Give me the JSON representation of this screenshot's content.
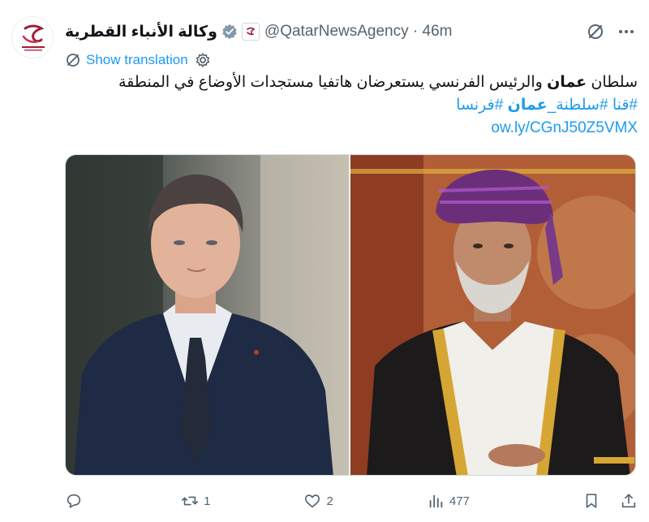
{
  "account": {
    "display_name": "وكالة الأنباء القطرية",
    "handle": "@QatarNewsAgency",
    "separator": "·",
    "time_ago": "46m",
    "avatar_icon": "qna-logo-icon",
    "verified_icon": "verified-badge-icon",
    "affiliate_icon": "affiliate-badge-icon"
  },
  "header_actions": {
    "grok_icon": "grok-icon",
    "more_icon": "more-dots-icon"
  },
  "translation": {
    "label": "Show translation",
    "icon": "translate-icon",
    "settings_icon": "gear-icon"
  },
  "tweet": {
    "text_part1": "سلطان ",
    "text_bold1": "عمان",
    "text_part2": " والرئيس الفرنسي يستعرضان هاتفيا مستجدات الأوضاع في المنطقة",
    "hashtag1": "#قنا",
    "hashtag2_pre": "#سلطنة_",
    "hashtag2_bold": "عمان",
    "hashtag3": "#فرنسا",
    "link": "ow.ly/CGnJ50Z5VMX"
  },
  "media": {
    "left_image": "photo-man-in-suit",
    "right_image": "photo-man-in-turban"
  },
  "actions": {
    "reply_icon": "reply-icon",
    "reply_count": "",
    "retweet_icon": "retweet-icon",
    "retweet_count": "1",
    "like_icon": "heart-icon",
    "like_count": "2",
    "views_icon": "views-icon",
    "views_count": "477",
    "bookmark_icon": "bookmark-icon",
    "share_icon": "share-icon"
  },
  "colors": {
    "accent": "#1d9bf0",
    "secondary_text": "#536471",
    "primary_text": "#0f1419",
    "brand": "#a11d36"
  }
}
